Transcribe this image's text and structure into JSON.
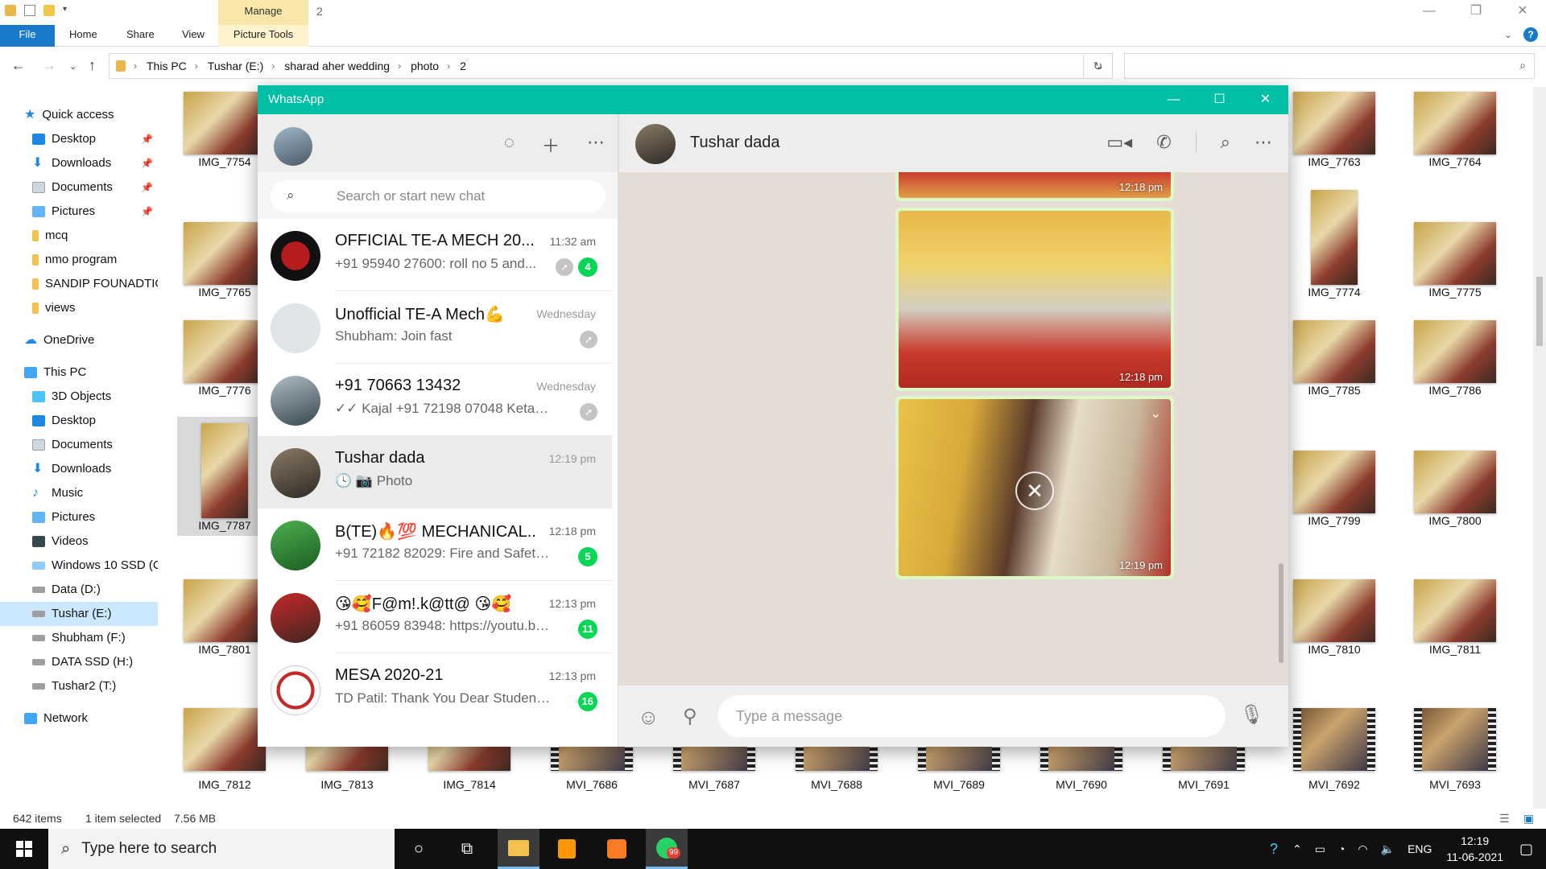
{
  "explorer": {
    "title_number": "2",
    "manage_tab": "Manage",
    "ribbon_tabs": [
      "File",
      "Home",
      "Share",
      "View",
      "Picture Tools"
    ],
    "breadcrumbs": [
      "This PC",
      "Tushar (E:)",
      "sharad aher wedding",
      "photo",
      "2"
    ],
    "nav": {
      "quick_access": "Quick access",
      "quick_items": [
        "Desktop",
        "Downloads",
        "Documents",
        "Pictures",
        "mcq",
        "nmo program",
        "SANDIP FOUNADTIO",
        "views"
      ],
      "onedrive": "OneDrive",
      "this_pc": "This PC",
      "pc_items": [
        "3D Objects",
        "Desktop",
        "Documents",
        "Downloads",
        "Music",
        "Pictures",
        "Videos",
        "Windows 10 SSD (C",
        "Data (D:)",
        "Tushar (E:)",
        "Shubham (F:)",
        "DATA SSD (H:)",
        "Tushar2 (T:)"
      ],
      "network": "Network"
    },
    "files": {
      "left_col": [
        "IMG_7754",
        "IMG_7765",
        "IMG_7776",
        "IMG_7787",
        "IMG_7801",
        "IMG_7812"
      ],
      "right_col_a": [
        "IMG_7763",
        "IMG_7774",
        "IMG_7785",
        "IMG_7799",
        "IMG_7810"
      ],
      "right_col_b": [
        "IMG_7764",
        "IMG_7775",
        "IMG_7786",
        "IMG_7800",
        "IMG_7811"
      ],
      "bottom_row": [
        "IMG_7813",
        "IMG_7814",
        "MVI_7686",
        "MVI_7687",
        "MVI_7688",
        "MVI_7689",
        "MVI_7690",
        "MVI_7691",
        "MVI_7692",
        "MVI_7693"
      ]
    },
    "status": {
      "count": "642 items",
      "selected": "1 item selected",
      "size": "7.56 MB"
    }
  },
  "whatsapp": {
    "title": "WhatsApp",
    "search_placeholder": "Search or start new chat",
    "chats": [
      {
        "name": "OFFICIAL TE-A MECH 20...",
        "time": "11:32 am",
        "message": "+91 95940 27600: roll no 5 and...",
        "unread": "4"
      },
      {
        "name": "Unofficial TE-A Mech💪",
        "time": "Wednesday",
        "message": "Shubham: Join fast",
        "unread": ""
      },
      {
        "name": "+91 70663 13432",
        "time": "Wednesday",
        "message": "✓✓ Kajal +91 72198 07048 Ketan Pd...",
        "unread": ""
      },
      {
        "name": "Tushar dada",
        "time": "12:19 pm",
        "message": "🕓 📷 Photo",
        "unread": ""
      },
      {
        "name": "B(TE)🔥💯 MECHANICAL..",
        "time": "12:18 pm",
        "message": "+91 72182 82029: Fire and Safety ||...",
        "unread": "5"
      },
      {
        "name": "😘🥰F@m!.k@tt@ 😘🥰",
        "time": "12:13 pm",
        "message": "+91 86059 83948: https://youtu.be...",
        "unread": "11"
      },
      {
        "name": "MESA 2020-21",
        "time": "12:13 pm",
        "message": "TD Patil: Thank You Dear Student f...",
        "unread": "16"
      }
    ],
    "contact": "Tushar dada",
    "messages": [
      {
        "time": "12:18 pm"
      },
      {
        "time": "12:18 pm"
      },
      {
        "time": "12:19 pm"
      }
    ],
    "composer_placeholder": "Type a message"
  },
  "taskbar": {
    "search_placeholder": "Type here to search",
    "whatsapp_badge": "99",
    "language": "ENG",
    "time": "12:19",
    "date": "11-06-2021"
  }
}
